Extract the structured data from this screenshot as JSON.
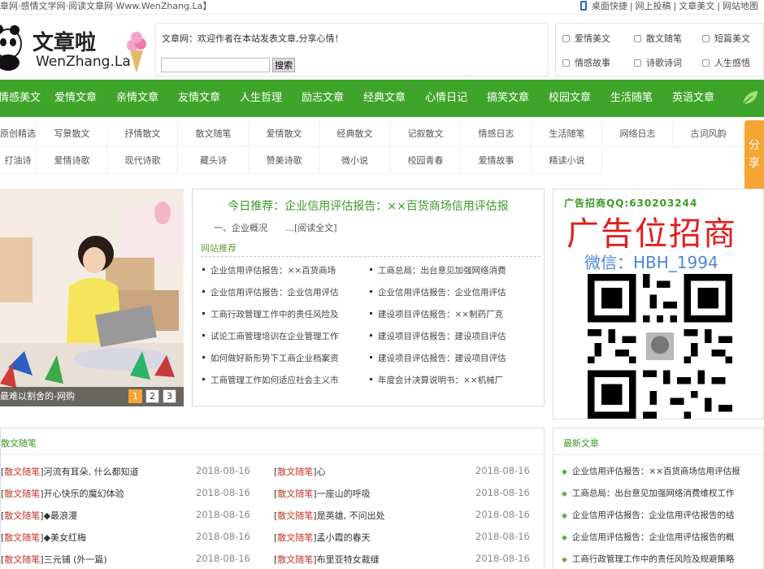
{
  "topbar": {
    "left_text": "章网·感情文学网·阅读文章网·Www.WenZhang.La】",
    "links": [
      "桌面快捷",
      "网上投稿",
      "文章美文",
      "网站地图"
    ]
  },
  "logo": {
    "chinese": "文章啦",
    "latin": "WenZhang.La"
  },
  "welcome": {
    "text": "文章网：欢迎作者在本站发表文章,分享心情！",
    "search_value": "",
    "search_button": "搜索"
  },
  "quick_links": [
    "爱情美文",
    "散文随笔",
    "短篇美文",
    "情感故事",
    "诗歌诗词",
    "人生感悟"
  ],
  "nav": [
    "情感美文",
    "爱情文章",
    "亲情文章",
    "友情文章",
    "人生哲理",
    "励志文章",
    "经典文章",
    "心情日记",
    "搞笑文章",
    "校园文章",
    "生活随笔",
    "英语文章"
  ],
  "subnav_row1": [
    "原创精选",
    "写景散文",
    "抒情散文",
    "散文随笔",
    "爱情散文",
    "经典散文",
    "记叙散文",
    "情感日志",
    "生活随笔",
    "网络日志",
    "古词风韵"
  ],
  "subnav_row2": [
    "打油诗",
    "爱情诗歌",
    "现代诗歌",
    "藏头诗",
    "赞美诗歌",
    "微小说",
    "校园青春",
    "爱情故事",
    "精读小说"
  ],
  "share_label": "分享",
  "slideshow": {
    "caption": "最难以割舍的-网购",
    "pages": [
      "1",
      "2",
      "3"
    ],
    "active": 0
  },
  "recommend": {
    "title": "今日推荐：企业信用评估报告：××百货商场信用评估报",
    "summary": "一、企业概况　　…[阅读全文]",
    "section_label": "网站推荐",
    "left": [
      "企业信用评估报告：××百货商场",
      "企业信用评估报告：企业信用评估",
      "工商行政管理工作中的责任风险及",
      "试论工商管理培训在企业管理工作",
      "如何做好新形势下工商企业档案资",
      "工商管理工作如何适应社会主义市"
    ],
    "right": [
      "工商总局：出台意见加强网络消费",
      "企业信用评估报告：企业信用评估",
      "建设项目评估报告：××制药厂克",
      "建设项目评估报告：建设项目评估",
      "建设项目评估报告：建设项目评估",
      "年度会计决算说明书：××机械厂"
    ]
  },
  "ad": {
    "header": "广告招商QQ:630203244",
    "headline": "广告位招商",
    "wechat": "微信：HBH_1994"
  },
  "essay": {
    "title": "散文随笔",
    "tag": "散文随笔",
    "left": [
      {
        "title": "河流有耳朵, 什么都知道",
        "date": "2018-08-16"
      },
      {
        "title": "开心快乐的魔幻体验",
        "date": "2018-08-16"
      },
      {
        "title": "◆最浪漫",
        "date": "2018-08-16"
      },
      {
        "title": "◆美女红梅",
        "date": "2018-08-16"
      },
      {
        "title": "三元铺 (外一篇)",
        "date": "2018-08-16"
      }
    ],
    "right": [
      {
        "title": "心",
        "date": "2018-08-16"
      },
      {
        "title": "一座山的呼吸",
        "date": "2018-08-16"
      },
      {
        "title": "是英雄, 不问出处",
        "date": "2018-08-16"
      },
      {
        "title": "孟小霞的春天",
        "date": "2018-08-16"
      },
      {
        "title": "布里亚特女裁缝",
        "date": "2018-08-16"
      }
    ]
  },
  "latest": {
    "title": "最新文章",
    "items": [
      "企业信用评估报告：××百货商场信用评估报",
      "工商总局：出台意见加强网络消费维权工作",
      "企业信用评估报告：企业信用评估报告的结",
      "企业信用评估报告：企业信用评估报告的概",
      "工商行政管理工作中的责任风险及规避策略"
    ]
  },
  "colors": {
    "nav_green": "#3fa52a",
    "share_orange": "#f4a533",
    "ad_red": "#e21c1c",
    "tag_red": "#c0392b"
  }
}
